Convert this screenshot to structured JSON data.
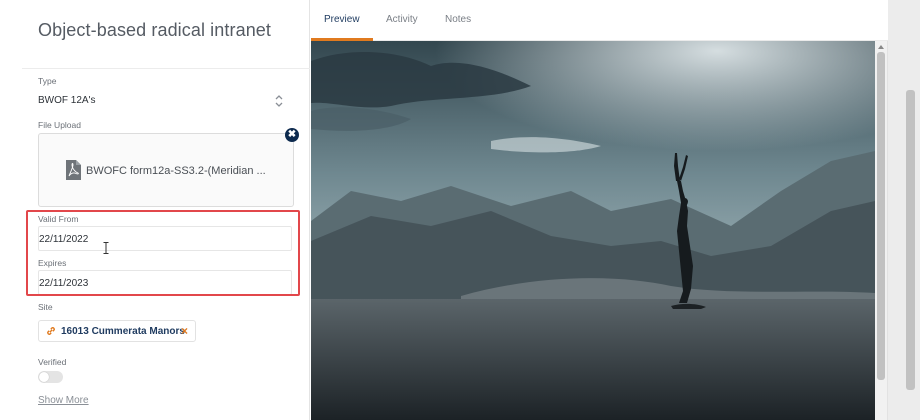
{
  "record": {
    "title": "Object-based radical intranet"
  },
  "form": {
    "type_label": "Type",
    "type_value": "BWOF 12A's",
    "file_upload_label": "File Upload",
    "file_name": "BWOFC form12a-SS3.2-(Meridian ...",
    "remove_symbol": "✖",
    "valid_from_label": "Valid From",
    "valid_from_value": "22/11/2022",
    "expires_label": "Expires",
    "expires_value": "22/11/2023",
    "site_label": "Site",
    "site_value": "16013 Cummerata Manors",
    "site_remove_symbol": "×",
    "verified_label": "Verified",
    "verified_on": false,
    "show_more": "Show More"
  },
  "tabs": [
    {
      "label": "Preview",
      "active": true
    },
    {
      "label": "Activity",
      "active": false
    },
    {
      "label": "Notes",
      "active": false
    }
  ],
  "colors": {
    "accent": "#e07a1f",
    "brand": "#1e3a5f",
    "highlight": "#e2474b"
  },
  "icons": {
    "select": "chevron-up-down-icon",
    "file": "pdf-file-icon",
    "remove": "close-circle-icon",
    "site": "link-icon"
  }
}
